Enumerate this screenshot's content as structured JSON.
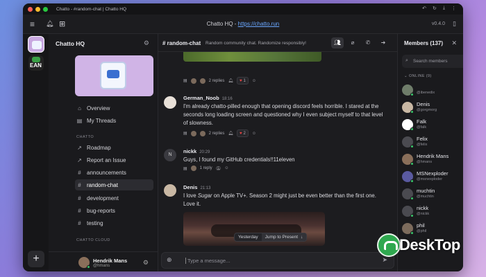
{
  "window": {
    "title": "Chatto - #random-chat | Chatto HQ",
    "url_label": "Chatto HQ",
    "url_sep": " - ",
    "url": "https://chatto.run",
    "version": "v0.4.0"
  },
  "workspace": {
    "name": "Chatto HQ",
    "server2_label": "EAN"
  },
  "sidebar": {
    "items_top": [
      {
        "icon": "home-icon",
        "label": "Overview"
      },
      {
        "icon": "threads-icon",
        "label": "My Threads"
      }
    ],
    "section_chatto": "CHATTO",
    "items_chatto": [
      {
        "icon": "external-link-icon",
        "label": "Roadmap"
      },
      {
        "icon": "external-link-icon",
        "label": "Report an Issue"
      },
      {
        "icon": "hash-icon",
        "label": "announcements"
      },
      {
        "icon": "hash-icon",
        "label": "random-chat"
      },
      {
        "icon": "hash-icon",
        "label": "development"
      },
      {
        "icon": "hash-icon",
        "label": "bug-reports"
      },
      {
        "icon": "hash-icon",
        "label": "testing"
      }
    ],
    "section_cloud": "CHATTO CLOUD",
    "user": {
      "name": "Hendrik Mans",
      "handle": "@hmans"
    }
  },
  "channel": {
    "name": "# random-chat",
    "description": "Random community chat. Randomize responsibly!"
  },
  "messages": [
    {
      "reactions": {
        "replies": "2 replies",
        "heart_count": "1"
      }
    },
    {
      "author": "German_Noob",
      "time": "18:16",
      "body": "I'm already chatto-pilled enough that opening discord feels horrible. I stared at the seconds long loading screen and questioned why I even subject myself to that level of slowness.",
      "reactions": {
        "replies": "2 replies",
        "heart_count": "2"
      }
    },
    {
      "author": "nickk",
      "avatar_letter": "N",
      "time": "20:29",
      "body": "Guys, I found my GitHub credentials!!11eleven",
      "reactions": {
        "replies": "1 reply"
      }
    },
    {
      "author": "Denis",
      "time": "21:13",
      "body_pre": "I love ",
      "body_em": "Sugar",
      "body_post": " on Apple TV+. Season 2 might just be even better than the first one. Love it."
    }
  ],
  "jump": {
    "date": "Yesterday",
    "button": "Jump to Present"
  },
  "composer": {
    "placeholder": "Type a message..."
  },
  "members": {
    "title": "Members (137)",
    "search_placeholder": "Search members",
    "online_label": "ONLINE (9)",
    "list": [
      {
        "name": "",
        "handle": "@ibenedix",
        "color": "#6f7d6a"
      },
      {
        "name": "Denis",
        "handle": "@gorgmorg",
        "color": "#c9b8a4"
      },
      {
        "name": "Falk",
        "handle": "@falk",
        "color": "#ffffff"
      },
      {
        "name": "Felix",
        "handle": "@felix",
        "color": "#4a4a50"
      },
      {
        "name": "Hendrik Mans",
        "handle": "@hmans",
        "color": "#8a6f5a"
      },
      {
        "name": "MSNexploder",
        "handle": "@msnexploder",
        "color": "#5a5aa0"
      },
      {
        "name": "muchtin",
        "handle": "@muchtin",
        "color": "#4a4a50"
      },
      {
        "name": "nickk",
        "handle": "@nickk",
        "color": "#4a4a50"
      },
      {
        "name": "phil",
        "handle": "@phil",
        "color": "#7c6b5c"
      }
    ]
  },
  "watermark": {
    "text": "DeskTop"
  }
}
